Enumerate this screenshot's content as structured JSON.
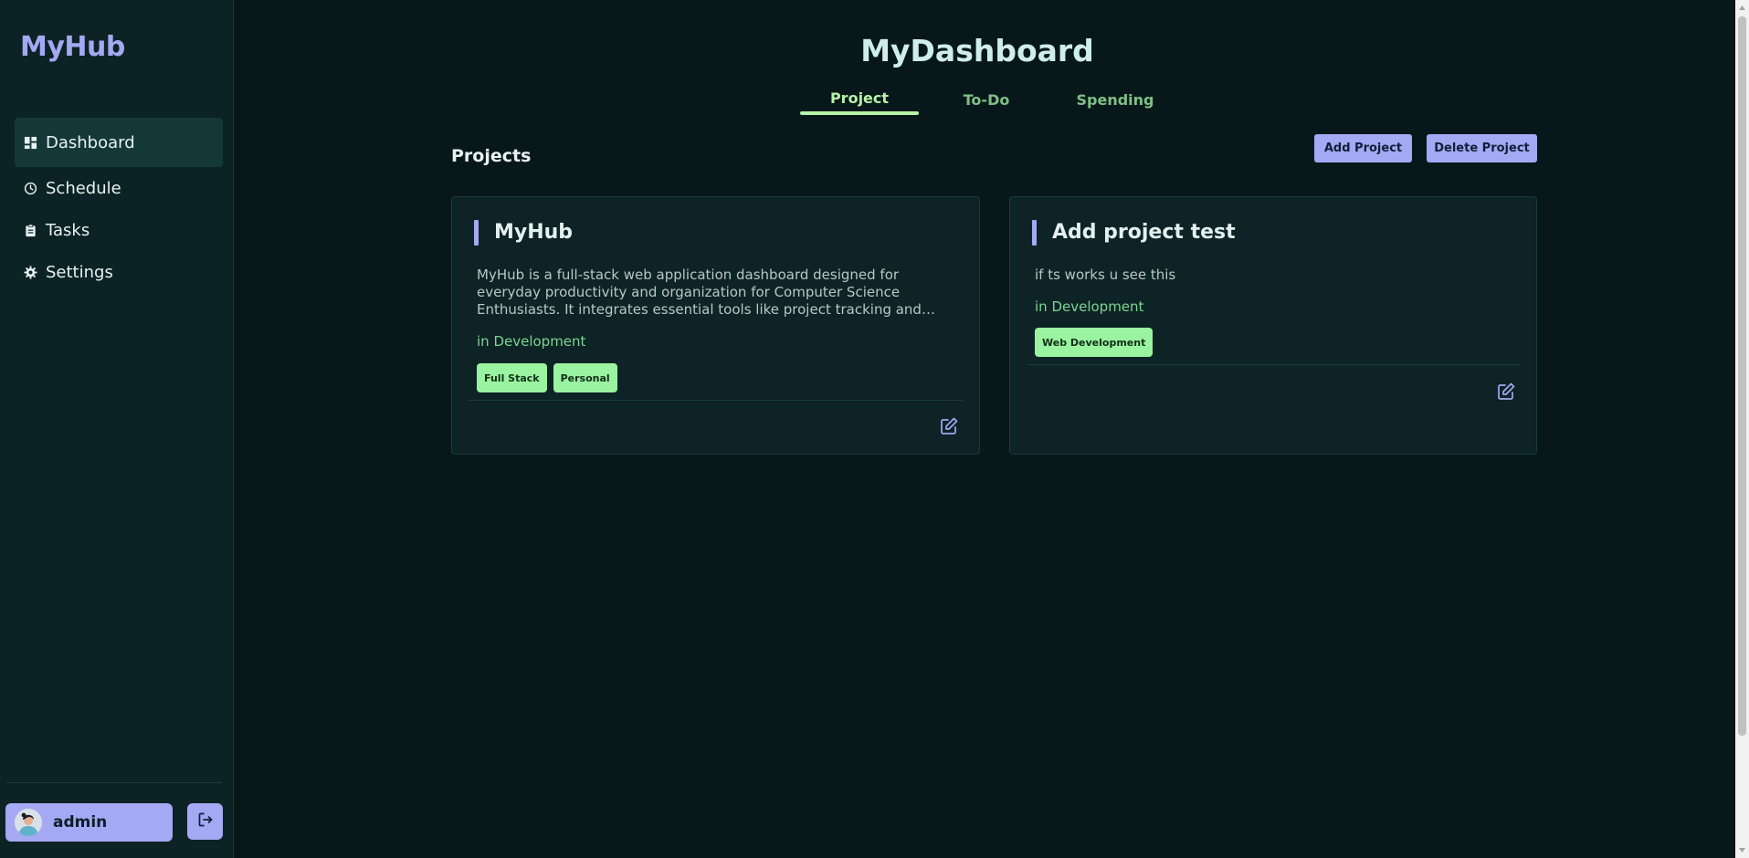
{
  "app": {
    "logo": "MyHub"
  },
  "sidebar": {
    "items": [
      {
        "label": "Dashboard",
        "icon": "dashboard-icon",
        "active": true
      },
      {
        "label": "Schedule",
        "icon": "clock-icon"
      },
      {
        "label": "Tasks",
        "icon": "clipboard-icon"
      },
      {
        "label": "Settings",
        "icon": "gear-icon"
      }
    ],
    "user": {
      "name": "admin"
    }
  },
  "header": {
    "title": "MyDashboard",
    "tabs": [
      {
        "label": "Project",
        "active": true
      },
      {
        "label": "To-Do"
      },
      {
        "label": "Spending"
      }
    ]
  },
  "projects": {
    "section_title": "Projects",
    "add_label": "Add Project",
    "delete_label": "Delete Project",
    "cards": [
      {
        "title": "MyHub",
        "description": "MyHub is a full-stack web application dashboard designed for everyday productivity and organization for Computer Science Enthusiasts. It integrates essential tools like project tracking and personal finance management",
        "status": "in Development",
        "tags": [
          "Full Stack",
          "Personal"
        ]
      },
      {
        "title": "Add project test",
        "description": "if ts works u see this",
        "status": "in Development",
        "tags": [
          "Web Development"
        ]
      }
    ]
  },
  "colors": {
    "background": "#08181a",
    "sidebar": "#0c2325",
    "accent": "#a5a8f2",
    "green": "#9af3a0",
    "status": "#7ed492"
  }
}
